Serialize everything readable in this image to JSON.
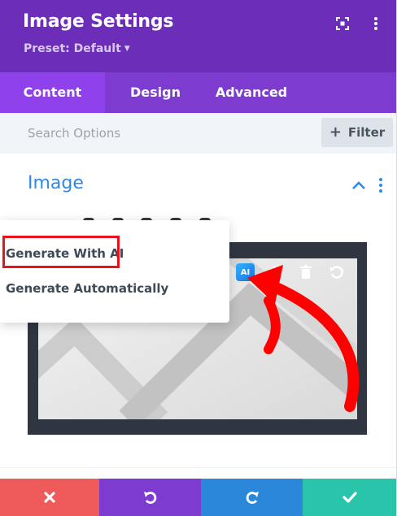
{
  "header": {
    "title": "Image Settings",
    "preset": "Preset: Default",
    "icons": [
      "focus-mode-icon",
      "kebab-menu-icon"
    ],
    "bg_color": "#6c2eb9"
  },
  "tabs": [
    {
      "label": "Content",
      "active": true
    },
    {
      "label": "Design",
      "active": false
    },
    {
      "label": "Advanced",
      "active": false
    }
  ],
  "search": {
    "placeholder": "Search Options",
    "value": "",
    "filter_label": "Filter"
  },
  "section": {
    "title": "Image",
    "icons": [
      "chevron-up-icon",
      "kebab-menu-icon"
    ]
  },
  "dropdown": {
    "items": [
      "Generate With AI",
      "Generate Automatically"
    ],
    "highlighted_item": "Generate With AI",
    "highlight_color": "#e8141a"
  },
  "image_toolbar": {
    "icons": [
      "ai-icon",
      "gear-icon",
      "trash-icon",
      "reset-icon"
    ],
    "ai_label": "AI"
  },
  "footer": {
    "buttons": [
      {
        "name": "cancel",
        "icon": "close-icon",
        "color": "#ef5a5a"
      },
      {
        "name": "undo",
        "icon": "undo-icon",
        "color": "#7e3bd0"
      },
      {
        "name": "redo",
        "icon": "redo-icon",
        "color": "#2b87da"
      },
      {
        "name": "save",
        "icon": "check-icon",
        "color": "#29c4a9"
      }
    ]
  }
}
